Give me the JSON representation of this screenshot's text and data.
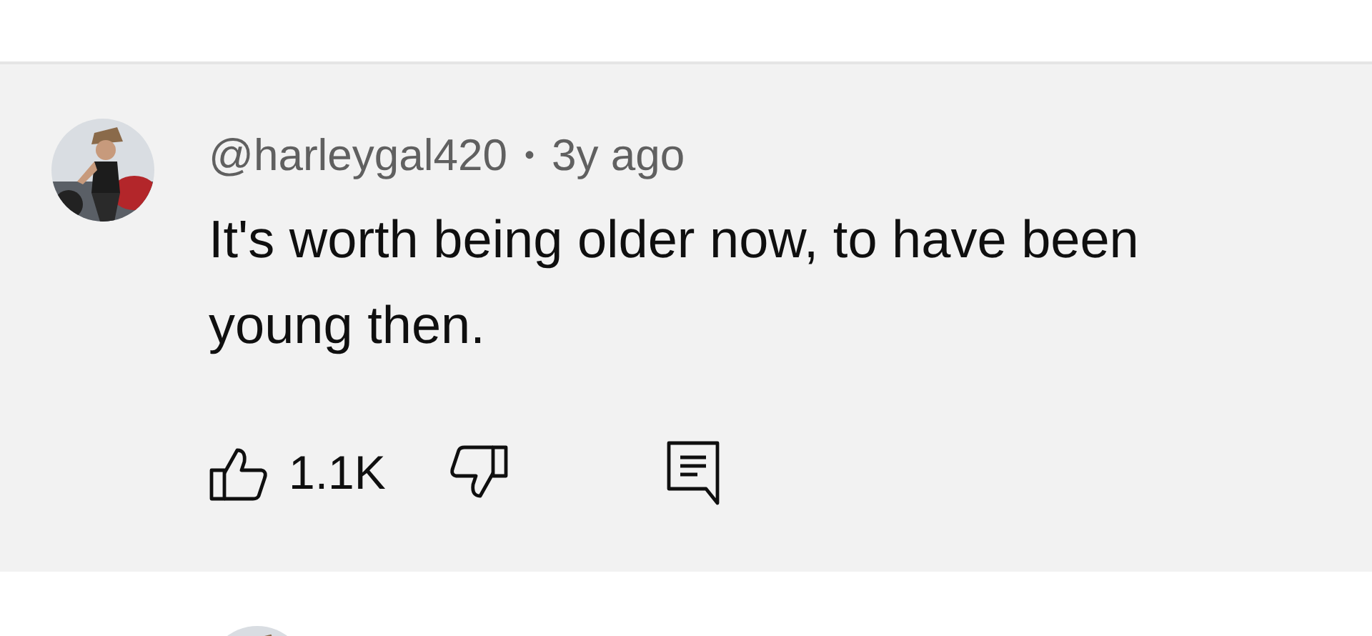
{
  "comment": {
    "author": "@harleygal420",
    "separator": "•",
    "time": "3y ago",
    "text": "It's worth being older now, to have been young then.",
    "likes": "1.1K"
  }
}
